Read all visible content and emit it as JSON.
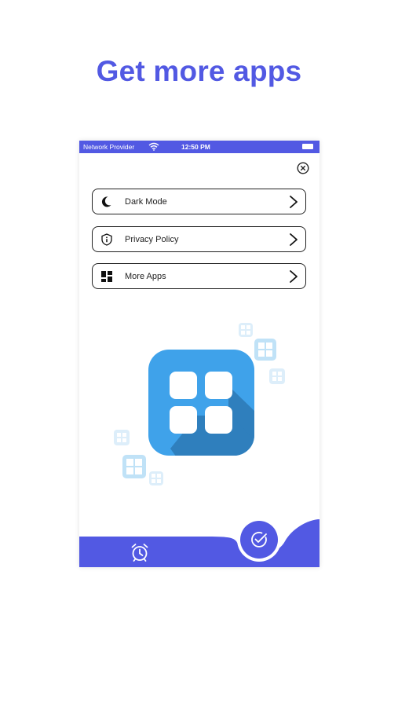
{
  "headline": "Get more apps",
  "status_bar": {
    "provider": "Network Provider",
    "time": "12:50 PM",
    "wifi_icon": "wifi-icon",
    "battery_icon": "battery-icon"
  },
  "menu": [
    {
      "label": "Dark Mode",
      "icon": "moon-icon"
    },
    {
      "label": "Privacy Policy",
      "icon": "shield-info-icon"
    },
    {
      "label": "More Apps",
      "icon": "grid-icon"
    }
  ],
  "colors": {
    "accent": "#5259e3",
    "app_icon_blue": "#3fa2ea",
    "app_icon_shadow": "#2f7fbd",
    "text": "#222222"
  },
  "icons": {
    "close": "close-circle-icon",
    "chevron": "chevron-right-icon",
    "alarm": "alarm-clock-icon",
    "check": "check-circle-icon",
    "app": "more-apps-grid-icon"
  }
}
